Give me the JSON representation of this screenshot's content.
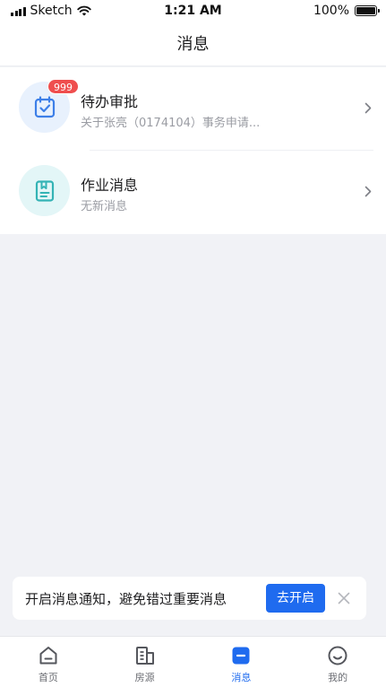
{
  "status_bar": {
    "carrier": "Sketch",
    "time": "1:21 AM",
    "battery": "100%",
    "battery_level": 1.0
  },
  "header": {
    "title": "消息"
  },
  "messages": [
    {
      "title": "待办审批",
      "subtitle": "关于张亮（0174104）事务申请...",
      "badge": "999",
      "icon": "calendar-check-icon"
    },
    {
      "title": "作业消息",
      "subtitle": "无新消息",
      "icon": "bookmark-doc-icon"
    }
  ],
  "notification": {
    "text": "开启消息通知，避免错过重要消息",
    "button": "去开启"
  },
  "tabs": [
    {
      "label": "首页",
      "icon": "home-icon"
    },
    {
      "label": "房源",
      "icon": "buildings-icon"
    },
    {
      "label": "消息",
      "icon": "message-icon",
      "active": true
    },
    {
      "label": "我的",
      "icon": "smile-icon"
    }
  ],
  "colors": {
    "accent": "#1f6bef",
    "badge": "#ef4e4e",
    "background": "#f1f2f6",
    "icon_blue": "#3d7fe8",
    "icon_teal": "#34b3b5"
  }
}
